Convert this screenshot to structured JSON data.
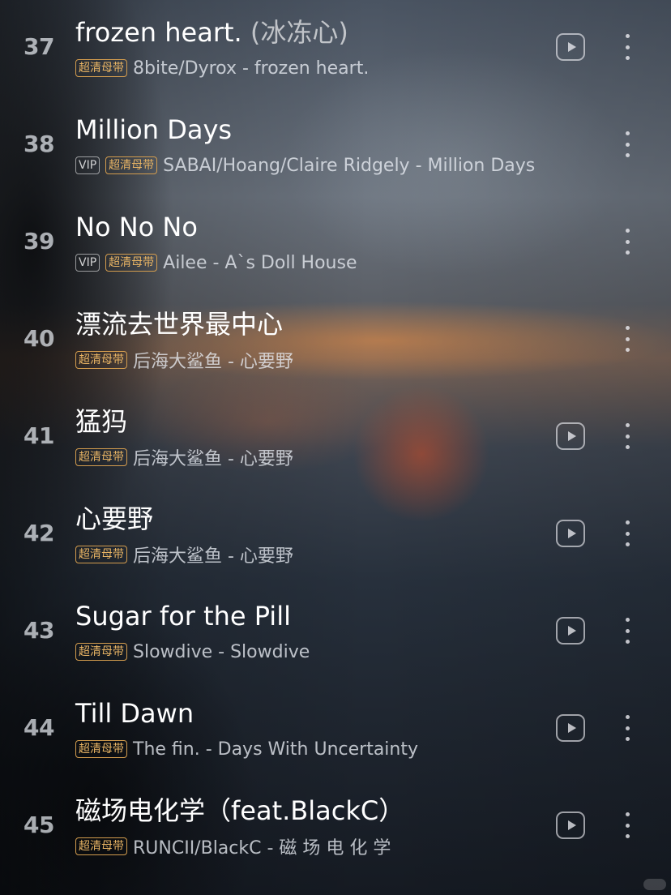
{
  "playlist": [
    {
      "index": "37",
      "title": "frozen heart. ",
      "title_extra": "(冰冻心)",
      "tags": [
        "超清母带"
      ],
      "artist": "8bite/Dyrox - frozen heart.",
      "has_play": true
    },
    {
      "index": "38",
      "title": "Million Days",
      "title_extra": "",
      "tags": [
        "VIP",
        "超清母带"
      ],
      "artist": "SABAI/Hoang/Claire Ridgely - Million Days",
      "has_play": false
    },
    {
      "index": "39",
      "title": "No No No",
      "title_extra": "",
      "tags": [
        "VIP",
        "超清母带"
      ],
      "artist": "Ailee - A`s Doll House",
      "has_play": false
    },
    {
      "index": "40",
      "title": "漂流去世界最中心",
      "title_extra": "",
      "tags": [
        "超清母带"
      ],
      "artist": "后海大鲨鱼 - 心要野",
      "has_play": false
    },
    {
      "index": "41",
      "title": "猛犸",
      "title_extra": "",
      "tags": [
        "超清母带"
      ],
      "artist": "后海大鲨鱼 - 心要野",
      "has_play": true
    },
    {
      "index": "42",
      "title": "心要野",
      "title_extra": "",
      "tags": [
        "超清母带"
      ],
      "artist": "后海大鲨鱼 - 心要野",
      "has_play": true
    },
    {
      "index": "43",
      "title": "Sugar for the Pill",
      "title_extra": "",
      "tags": [
        "超清母带"
      ],
      "artist": "Slowdive - Slowdive",
      "has_play": true
    },
    {
      "index": "44",
      "title": "Till Dawn",
      "title_extra": "",
      "tags": [
        "超清母带"
      ],
      "artist": "The fin. - Days With Uncertainty",
      "has_play": true
    },
    {
      "index": "45",
      "title": "磁场电化学（feat.BlackC）",
      "title_extra": "",
      "tags": [
        "超清母带"
      ],
      "artist": "RUNCII/BlackC - 磁 场 电 化 学",
      "has_play": true
    }
  ],
  "icons": {
    "play": "play-icon",
    "more": "more-vertical-icon"
  },
  "colors": {
    "title": "#ffffff",
    "hq_tag": "#e8b464",
    "vip_tag": "#c8ccd2"
  }
}
